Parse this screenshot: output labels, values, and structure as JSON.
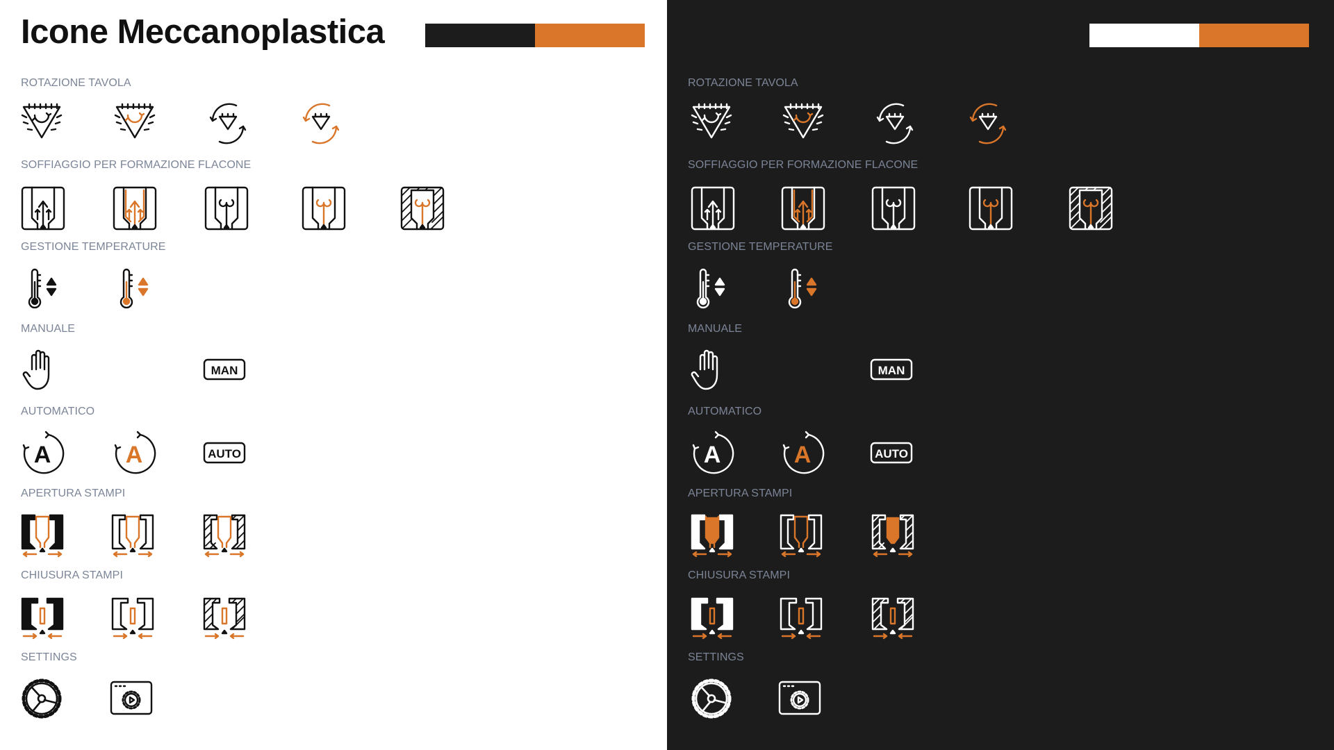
{
  "title": "Icone Meccanoplastica",
  "colors": {
    "accent": "#d9762a",
    "black": "#1d1c1c",
    "white": "#ffffff",
    "label": "#7b8597"
  },
  "sections": [
    {
      "label": "ROTAZIONE TAVOLA",
      "icons": [
        "table-rotation-icon",
        "table-rotation-accent-icon",
        "table-rotation-arrows-icon",
        "table-rotation-arrows-accent-icon"
      ]
    },
    {
      "label": "SOFFIAGGIO PER FORMAZIONE FLACONE",
      "icons": [
        "blow-molding-icon",
        "blow-molding-accent-icon",
        "blow-molding-outline-icon",
        "blow-molding-outline-accent-icon",
        "blow-molding-hatched-icon"
      ]
    },
    {
      "label": "GESTIONE TEMPERATURE",
      "icons": [
        "thermometer-updown-icon",
        "thermometer-updown-accent-icon"
      ]
    },
    {
      "label": "MANUALE",
      "icons": [
        "hand-icon",
        "man-badge-icon"
      ],
      "badge_text": "MAN"
    },
    {
      "label": "AUTOMATICO",
      "icons": [
        "auto-cycle-icon",
        "auto-cycle-accent-icon",
        "auto-badge-icon"
      ],
      "badge_text": "AUTO",
      "glyph": "A"
    },
    {
      "label": "APERTURA STAMPI",
      "icons": [
        "mold-open-filled-icon",
        "mold-open-outline-icon",
        "mold-open-hatched-icon"
      ]
    },
    {
      "label": "CHIUSURA STAMPI",
      "icons": [
        "mold-close-filled-icon",
        "mold-close-outline-icon",
        "mold-close-hatched-icon"
      ]
    },
    {
      "label": "SETTINGS",
      "icons": [
        "settings-gear-icon",
        "settings-window-icon"
      ]
    }
  ]
}
